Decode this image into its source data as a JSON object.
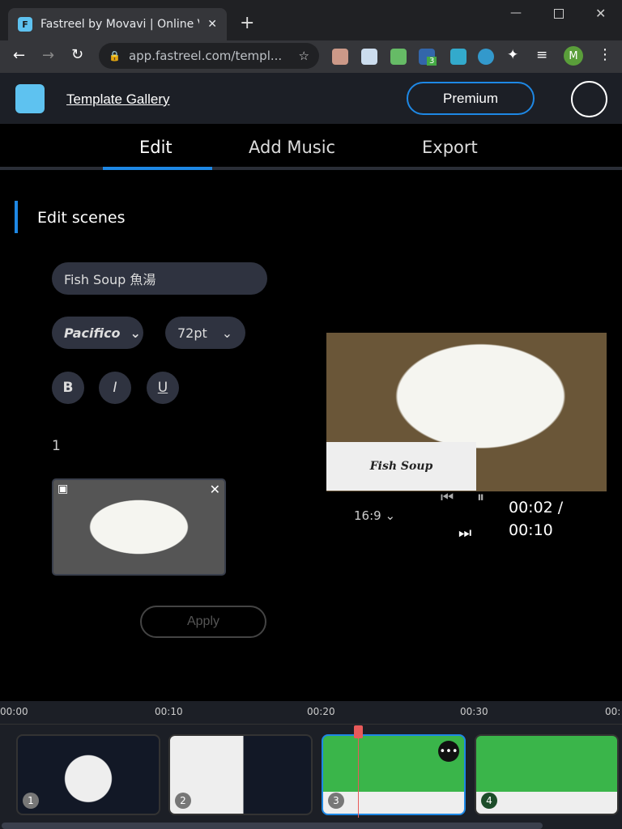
{
  "browser": {
    "tab_title": "Fastreel by Movavi | Online Video Maker",
    "url": "app.fastreel.com/templ...",
    "profile": "M",
    "ext_badge": "3"
  },
  "header": {
    "title": "Template Gallery",
    "premium": "Premium"
  },
  "tabs": [
    {
      "label": "Edit",
      "active": true
    },
    {
      "label": "Add Music"
    },
    {
      "label": "Export"
    }
  ],
  "editor": {
    "section": "Edit scenes",
    "text_value": "Fish Soup 魚湯",
    "font": "Pacifico",
    "size": "72pt",
    "bold": "B",
    "italic": "I",
    "underline": "U",
    "media_index": "1",
    "apply": "Apply"
  },
  "preview": {
    "caption": "Fish Soup",
    "ratio": "16:9",
    "time": "00:02 /",
    "duration": "00:10"
  },
  "timeline": {
    "ticks": [
      "00:00",
      "00:10",
      "00:20",
      "00:30",
      "00:"
    ],
    "clips": [
      {
        "n": "1"
      },
      {
        "n": "2"
      },
      {
        "n": "3",
        "selected": true
      },
      {
        "n": "4"
      }
    ],
    "accent": "#1e88e5",
    "playhead": "#e85a5a"
  }
}
